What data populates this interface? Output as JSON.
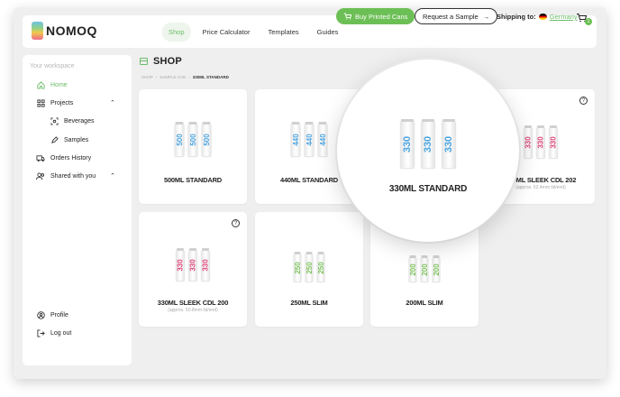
{
  "app": {
    "brand": "NOMOQ"
  },
  "nav": {
    "items": [
      {
        "label": "Shop",
        "active": true
      },
      {
        "label": "Price Calculator"
      },
      {
        "label": "Templates"
      },
      {
        "label": "Guides"
      }
    ],
    "buy_label": "Buy Printed Cans",
    "sample_label": "Request a Sample",
    "shipping_label": "Shipping to:",
    "shipping_country": "Germany",
    "cart_count": "1"
  },
  "sidebar": {
    "workspace_label": "Your workspace",
    "items": [
      {
        "label": "Home",
        "icon": "home-icon"
      },
      {
        "label": "Projects",
        "icon": "grid-icon"
      },
      {
        "label": "Beverages",
        "icon": "scan-icon"
      },
      {
        "label": "Samples",
        "icon": "pen-icon"
      },
      {
        "label": "Orders History",
        "icon": "truck-icon"
      },
      {
        "label": "Shared with you",
        "icon": "users-icon"
      },
      {
        "label": "Profile",
        "icon": "user-circle-icon"
      },
      {
        "label": "Log out",
        "icon": "logout-icon"
      }
    ]
  },
  "page": {
    "title": "SHOP",
    "breadcrumb": [
      "Shop",
      "Sample Can",
      "330ml Standard"
    ]
  },
  "products": [
    {
      "title": "500ML STANDARD",
      "can_label": "500",
      "color": "#4aa3df",
      "sub": ""
    },
    {
      "title": "440ML STANDARD",
      "can_label": "440",
      "color": "#4aa3df",
      "sub": ""
    },
    {
      "title": "330ML STANDARD",
      "can_label": "330",
      "color": "#4aa3df",
      "sub": ""
    },
    {
      "title": "330ML SLEEK CDL 202",
      "can_label": "330",
      "color": "#e0457b",
      "sub": "(approx. 52.4mm lid/end)"
    },
    {
      "title": "330ML SLEEK CDL 200",
      "can_label": "330",
      "color": "#e0457b",
      "sub": "(approx. 50.8mm lid/end)"
    },
    {
      "title": "250ML SLIM",
      "can_label": "250",
      "color": "#7cc35a",
      "sub": ""
    },
    {
      "title": "200ML SLIM",
      "can_label": "200",
      "color": "#7cc35a",
      "sub": ""
    }
  ]
}
